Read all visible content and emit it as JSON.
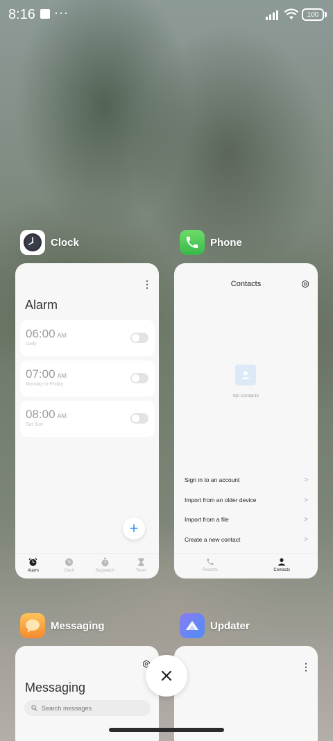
{
  "status_bar": {
    "time": "8:16",
    "dots": "···",
    "battery_level": "100",
    "icons": [
      "notification-square-icon",
      "signal-icon",
      "wifi-icon",
      "battery-icon"
    ]
  },
  "recents": {
    "apps": [
      {
        "name": "Clock",
        "icon": "clock-app-icon",
        "preview": {
          "title": "Alarm",
          "alarms": [
            {
              "time": "06:00",
              "ampm": "AM",
              "repeat": "Daily",
              "enabled": false
            },
            {
              "time": "07:00",
              "ampm": "AM",
              "repeat": "Monday to Friday",
              "enabled": false
            },
            {
              "time": "08:00",
              "ampm": "AM",
              "repeat": "Sat Sun",
              "enabled": false
            }
          ],
          "add_icon": "+",
          "tabs": [
            {
              "label": "Alarm",
              "icon": "alarm-icon",
              "active": true
            },
            {
              "label": "Clock",
              "icon": "clock-icon",
              "active": false
            },
            {
              "label": "Stopwatch",
              "icon": "stopwatch-icon",
              "active": false
            },
            {
              "label": "Timer",
              "icon": "timer-icon",
              "active": false
            }
          ]
        }
      },
      {
        "name": "Phone",
        "icon": "phone-app-icon",
        "preview": {
          "title": "Contacts",
          "empty_text": "No contacts",
          "actions": [
            "Sign in to an account",
            "Import from an older device",
            "Import from a file",
            "Create a new contact"
          ],
          "tabs": [
            {
              "label": "Recents",
              "icon": "phone-icon",
              "active": false
            },
            {
              "label": "Contacts",
              "icon": "person-icon",
              "active": true
            }
          ]
        }
      },
      {
        "name": "Messaging",
        "icon": "messaging-app-icon",
        "preview": {
          "title": "Messaging",
          "search_placeholder": "Search messages"
        }
      },
      {
        "name": "Updater",
        "icon": "updater-app-icon",
        "preview": {}
      }
    ],
    "close_label": "×",
    "accent_color": "#2b8ee8"
  }
}
